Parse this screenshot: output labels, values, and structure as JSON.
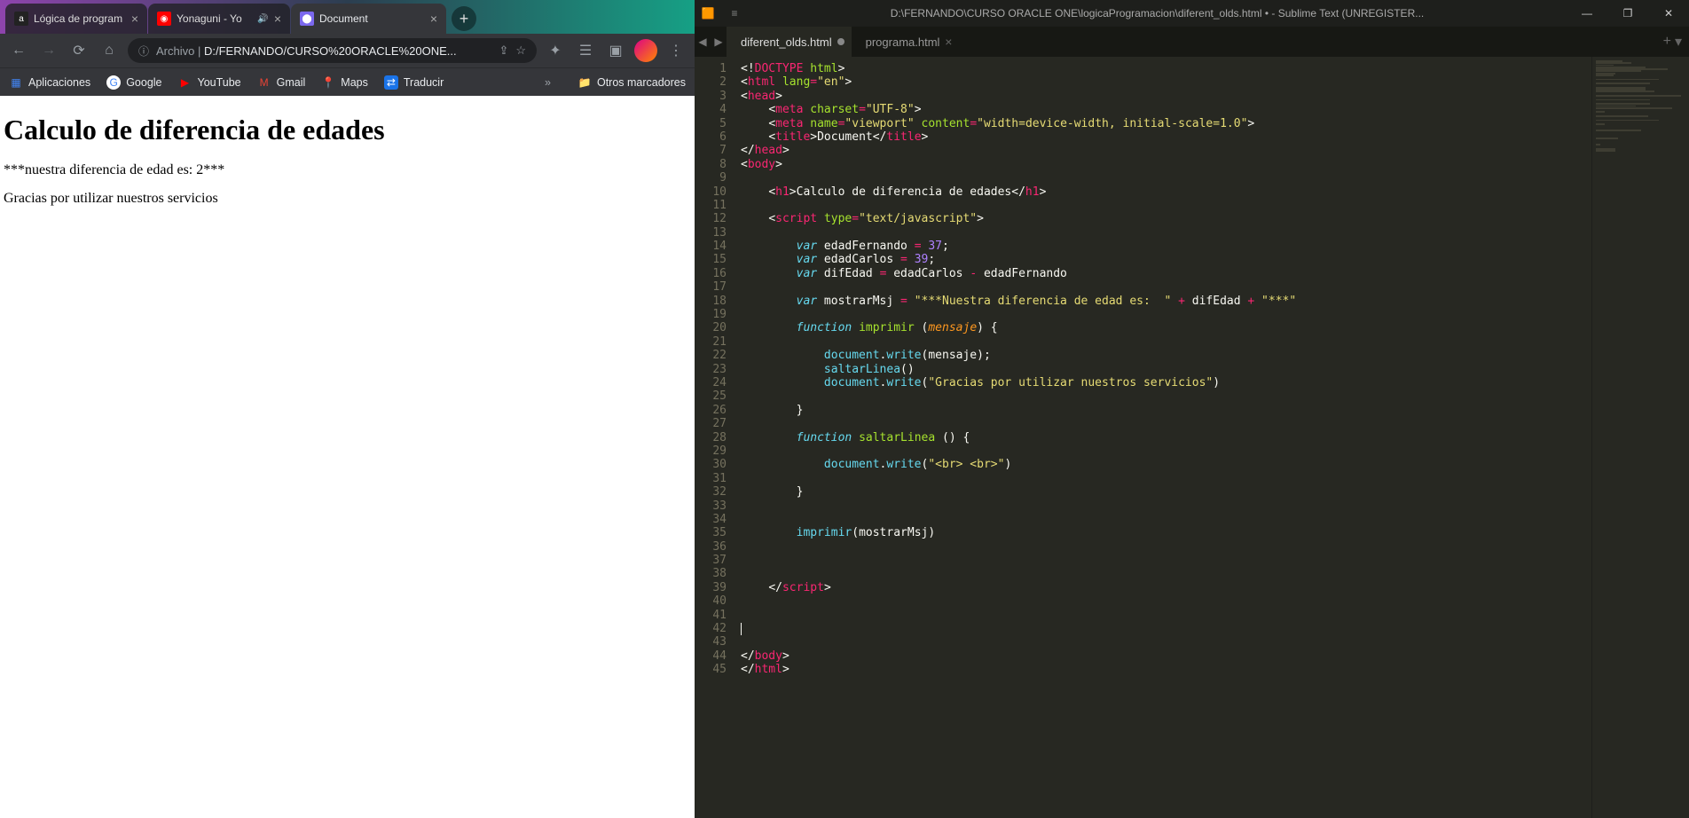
{
  "chrome": {
    "tabs": [
      {
        "title": "Lógica de program",
        "active": false,
        "icon": "a"
      },
      {
        "title": "Yonaguni - Yo",
        "active": false,
        "icon": "▶",
        "audio": true
      },
      {
        "title": "Document",
        "active": true,
        "icon": "●"
      }
    ],
    "url_proto": "Archivo |",
    "url": "D:/FERNANDO/CURSO%20ORACLE%20ONE...",
    "bookmarks": [
      {
        "label": "Aplicaciones",
        "icon": "⠿"
      },
      {
        "label": "Google",
        "icon": "G"
      },
      {
        "label": "YouTube",
        "icon": "▶"
      },
      {
        "label": "Gmail",
        "icon": "M"
      },
      {
        "label": "Maps",
        "icon": "📍"
      },
      {
        "label": "Traducir",
        "icon": "⇄"
      }
    ],
    "other_bookmarks": "Otros marcadores",
    "page": {
      "h1": "Calculo de diferencia de edades",
      "p1": "***nuestra diferencia de edad es: 2***",
      "p2": "Gracias por utilizar nuestros servicios"
    }
  },
  "sublime": {
    "title": "D:\\FERNANDO\\CURSO ORACLE ONE\\logicaProgramacion\\diferent_olds.html • - Sublime Text (UNREGISTER...",
    "tabs": [
      {
        "name": "diferent_olds.html",
        "active": true,
        "dirty": true
      },
      {
        "name": "programa.html",
        "active": false,
        "dirty": false
      }
    ],
    "lines": 45,
    "cursor_line": 42,
    "code": {
      "varEdadFernando": "var edadFernando = 37;",
      "varEdadCarlos": "var edadCarlos = 39;"
    }
  }
}
